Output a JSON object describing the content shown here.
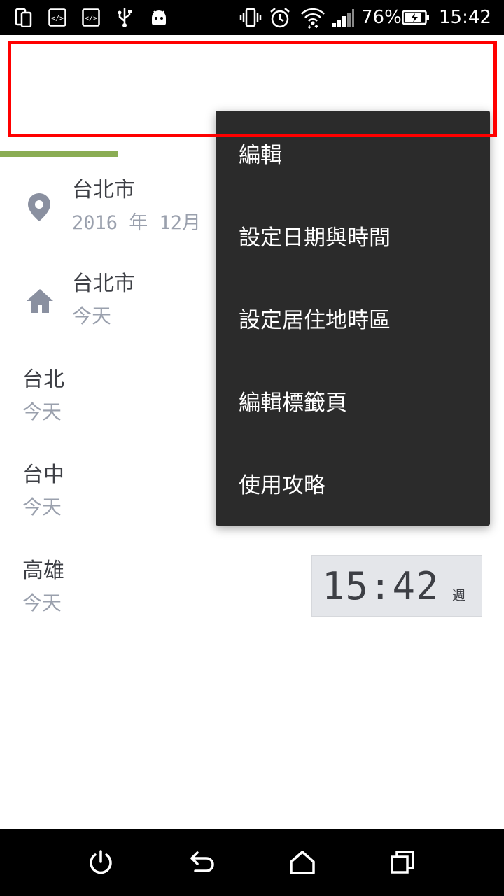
{
  "status_bar": {
    "icons_left": [
      "phone-copy-icon",
      "developer-code-icon",
      "developer-code-icon",
      "usb-icon",
      "android-icon"
    ],
    "icons_right": [
      "vibrate-icon",
      "alarm-icon",
      "wifi-icon",
      "signal-icon",
      "battery-charging-icon"
    ],
    "battery_percent": "76%",
    "time": "15:42"
  },
  "list": {
    "rows": [
      {
        "city": "台北市",
        "sub": "2016 年 12月",
        "icon": "location-pin-icon"
      },
      {
        "city": "台北市",
        "sub": "今天",
        "icon": "home-icon"
      },
      {
        "city": "台北",
        "sub": "今天"
      },
      {
        "city": "台中",
        "sub": "今天"
      },
      {
        "city": "高雄",
        "sub": "今天"
      }
    ]
  },
  "clock_card": {
    "time": "15:42",
    "day_of_week": "週"
  },
  "menu": {
    "items": [
      "編輯",
      "設定日期與時間",
      "設定居住地時區",
      "編輯標籤頁",
      "使用攻略"
    ]
  },
  "nav_bar": {
    "icons": [
      "power-icon",
      "back-icon",
      "home-nav-icon",
      "recents-icon"
    ]
  },
  "colors": {
    "tab_accent": "#8bad54",
    "highlight": "#ff0000",
    "menu_bg": "#2b2b2b",
    "secondary_text": "#9aa0ad"
  }
}
